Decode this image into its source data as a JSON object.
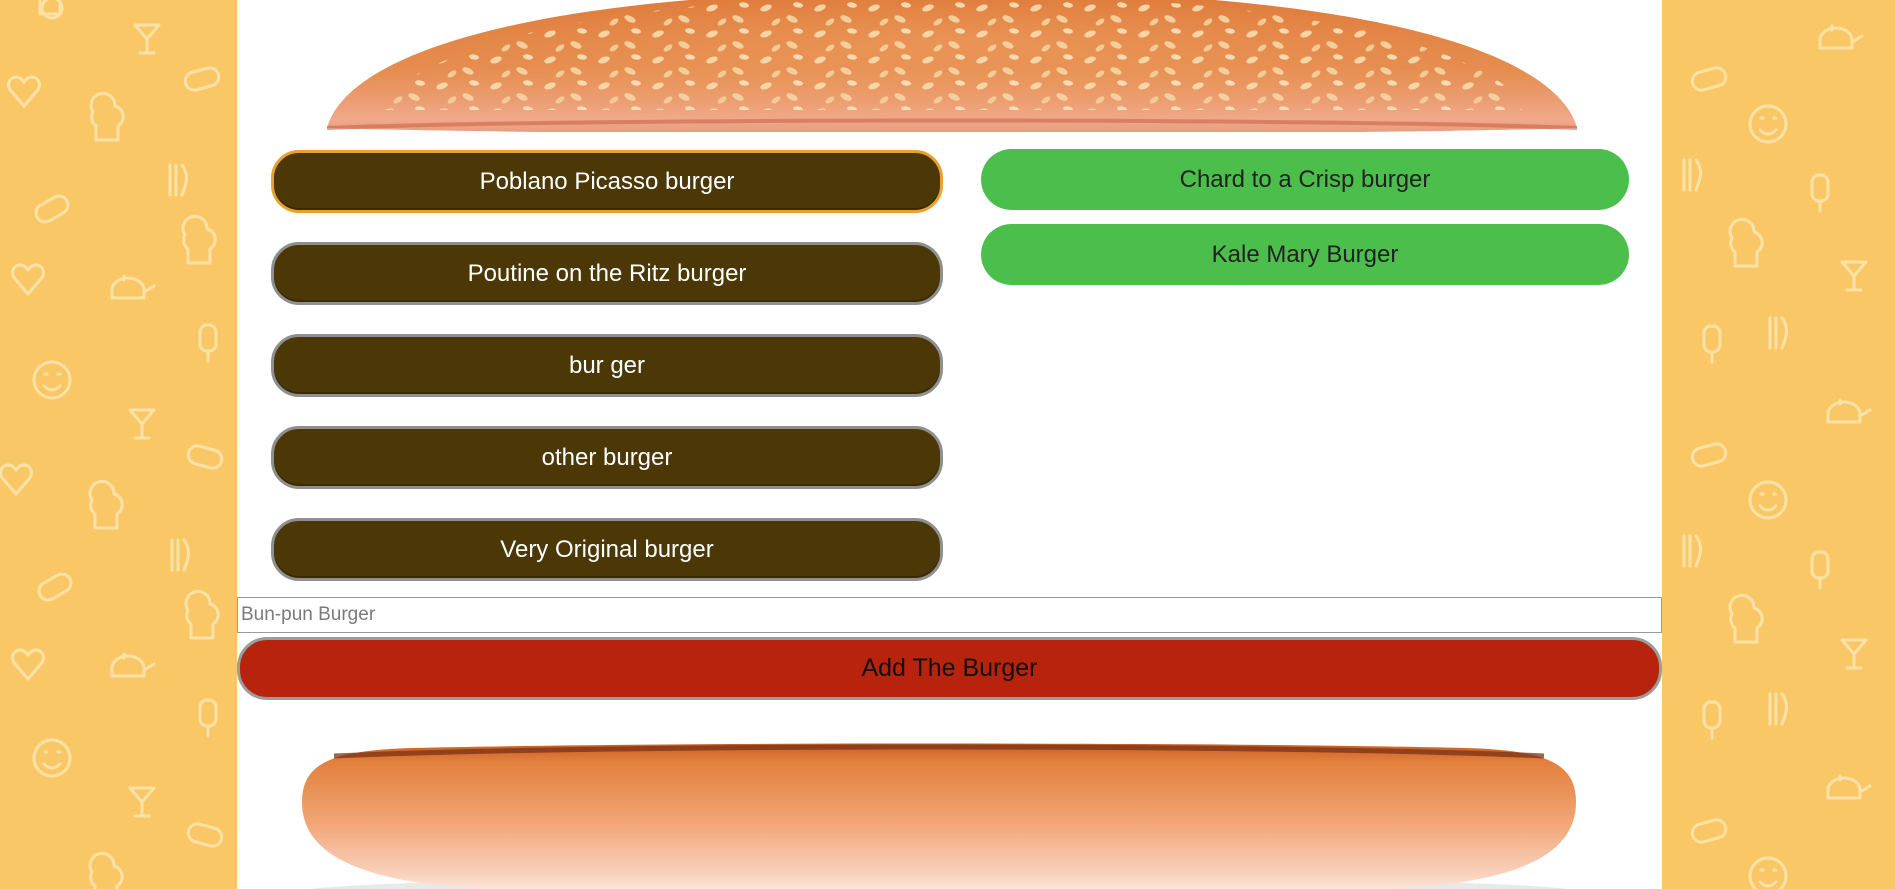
{
  "page": {
    "background_color": "#f9c766",
    "panel_color": "#ffffff"
  },
  "background_pattern": {
    "icons": [
      "chef-hat-icon",
      "heart-icon",
      "fork-knife-icon",
      "hot-dog-icon",
      "teapot-icon",
      "smiley-icon",
      "cocktail-glass-icon",
      "popsicle-icon"
    ]
  },
  "uneaten_burgers": {
    "items": [
      {
        "label": "Poblano Picasso burger",
        "focused": true
      },
      {
        "label": "Poutine on the Ritz burger",
        "focused": false
      },
      {
        "label": "bur ger",
        "focused": false
      },
      {
        "label": "other burger",
        "focused": false
      },
      {
        "label": "Very Original burger",
        "focused": false
      }
    ],
    "button_color": "#4b3806"
  },
  "devoured_burgers": {
    "items": [
      {
        "label": "Chard to a Crisp burger"
      },
      {
        "label": "Kale Mary Burger"
      }
    ],
    "item_color": "#4cbe4c"
  },
  "add_form": {
    "input_value": "",
    "input_placeholder": "Bun-pun Burger",
    "submit_label": "Add The Burger",
    "submit_color": "#b8230e"
  },
  "images": {
    "top_bun": "sesame-top-bun-image",
    "bottom_bun": "bottom-bun-image"
  }
}
